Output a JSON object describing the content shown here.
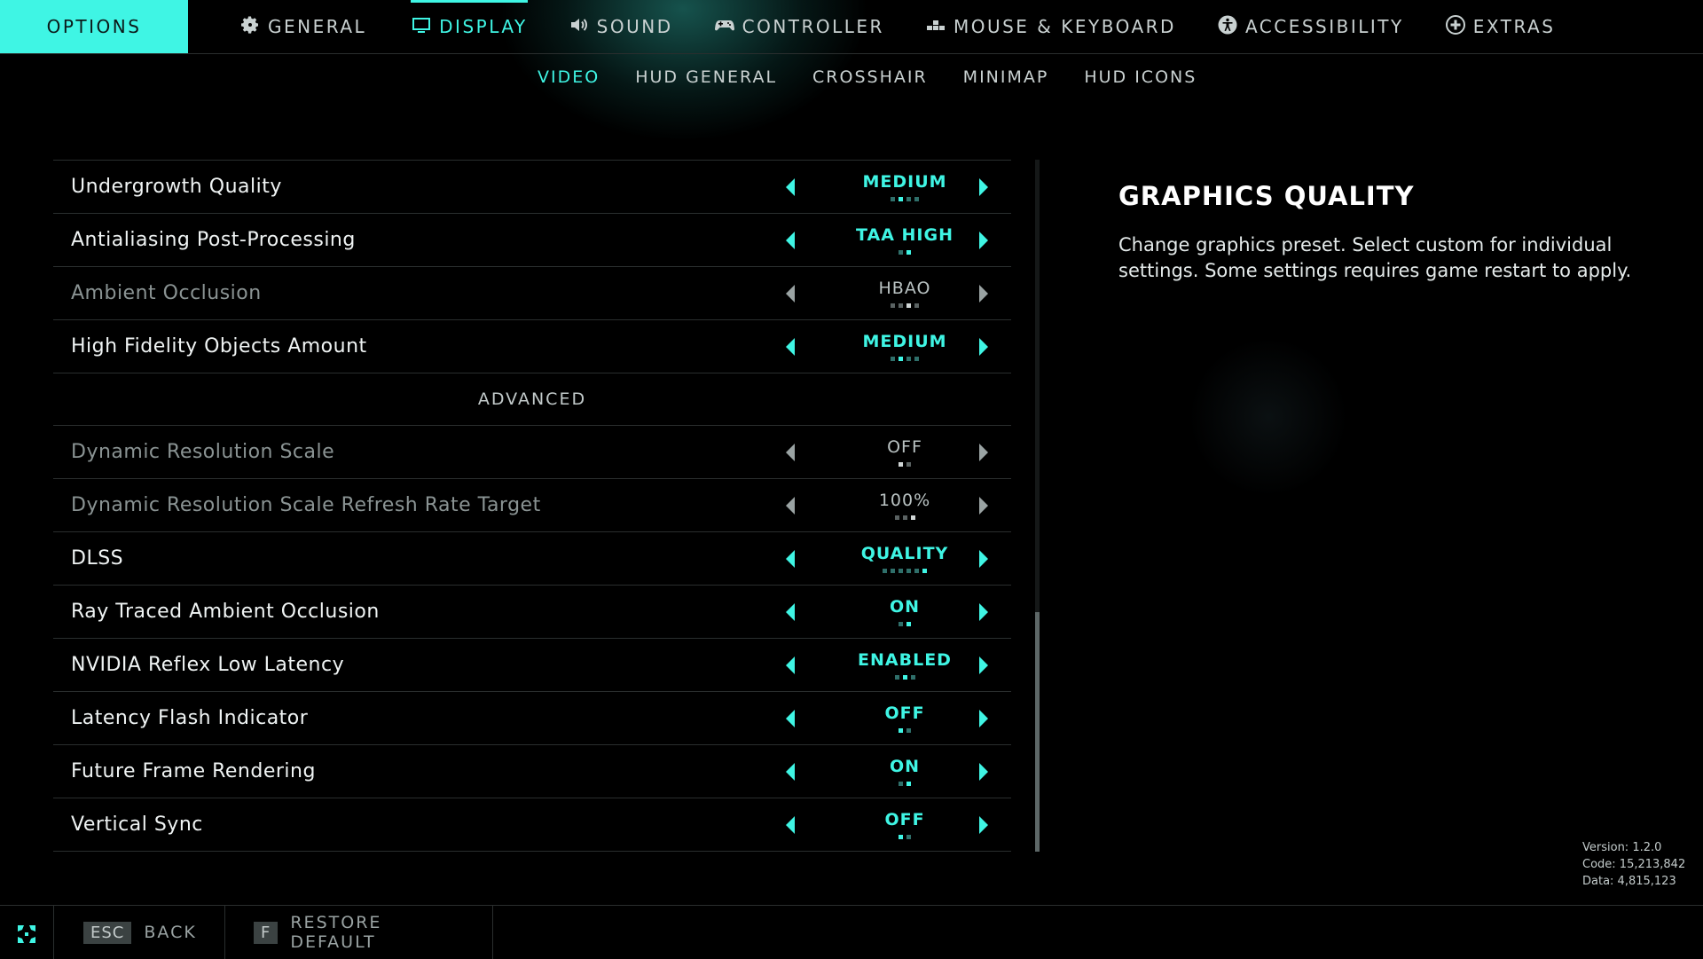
{
  "header": {
    "options_label": "OPTIONS",
    "tabs": [
      {
        "label": "GENERAL",
        "icon": "gear-icon"
      },
      {
        "label": "DISPLAY",
        "icon": "monitor-icon",
        "active": true
      },
      {
        "label": "SOUND",
        "icon": "speaker-icon"
      },
      {
        "label": "CONTROLLER",
        "icon": "gamepad-icon"
      },
      {
        "label": "MOUSE & KEYBOARD",
        "icon": "keyboard-icon"
      },
      {
        "label": "ACCESSIBILITY",
        "icon": "accessibility-icon"
      },
      {
        "label": "EXTRAS",
        "icon": "plus-circle-icon"
      }
    ]
  },
  "subtabs": [
    {
      "label": "VIDEO",
      "active": true
    },
    {
      "label": "HUD GENERAL"
    },
    {
      "label": "CROSSHAIR"
    },
    {
      "label": "MINIMAP"
    },
    {
      "label": "HUD ICONS"
    }
  ],
  "settings": {
    "rows": [
      {
        "label": "Undergrowth Quality",
        "value": "MEDIUM",
        "dots": 4,
        "active_dot": 1,
        "dim": false
      },
      {
        "label": "Antialiasing Post-Processing",
        "value": "TAA HIGH",
        "dots": 2,
        "active_dot": 1,
        "dim": false
      },
      {
        "label": "Ambient Occlusion",
        "value": "HBAO",
        "dots": 4,
        "active_dot": 2,
        "dim": true
      },
      {
        "label": "High Fidelity Objects Amount",
        "value": "MEDIUM",
        "dots": 4,
        "active_dot": 1,
        "dim": false
      }
    ],
    "section_header": "ADVANCED",
    "advanced_rows": [
      {
        "label": "Dynamic Resolution Scale",
        "value": "OFF",
        "dots": 2,
        "active_dot": 0,
        "dim": true
      },
      {
        "label": "Dynamic Resolution Scale Refresh Rate Target",
        "value": "100%",
        "dots": 3,
        "active_dot": 2,
        "dim": true
      },
      {
        "label": "DLSS",
        "value": "QUALITY",
        "dots": 6,
        "active_dot": 5,
        "dim": false
      },
      {
        "label": "Ray Traced Ambient Occlusion",
        "value": "ON",
        "dots": 2,
        "active_dot": 1,
        "dim": false
      },
      {
        "label": "NVIDIA Reflex Low Latency",
        "value": "ENABLED",
        "dots": 3,
        "active_dot": 1,
        "dim": false
      },
      {
        "label": "Latency Flash Indicator",
        "value": "OFF",
        "dots": 2,
        "active_dot": 0,
        "dim": false
      },
      {
        "label": "Future Frame Rendering",
        "value": "ON",
        "dots": 2,
        "active_dot": 1,
        "dim": false
      },
      {
        "label": "Vertical Sync",
        "value": "OFF",
        "dots": 2,
        "active_dot": 0,
        "dim": false
      }
    ]
  },
  "info": {
    "title": "GRAPHICS QUALITY",
    "description": "Change graphics preset. Select custom for individual settings. Some settings requires game restart to apply."
  },
  "version": {
    "version": "Version: 1.2.0",
    "code": "Code: 15,213,842",
    "data": "Data: 4,815,123"
  },
  "footer": {
    "back_key": "ESC",
    "back_label": "BACK",
    "restore_key": "F",
    "restore_label": "RESTORE DEFAULT"
  },
  "colors": {
    "accent": "#3ff5e4",
    "background": "#000000",
    "divider": "#2a2e2e"
  }
}
